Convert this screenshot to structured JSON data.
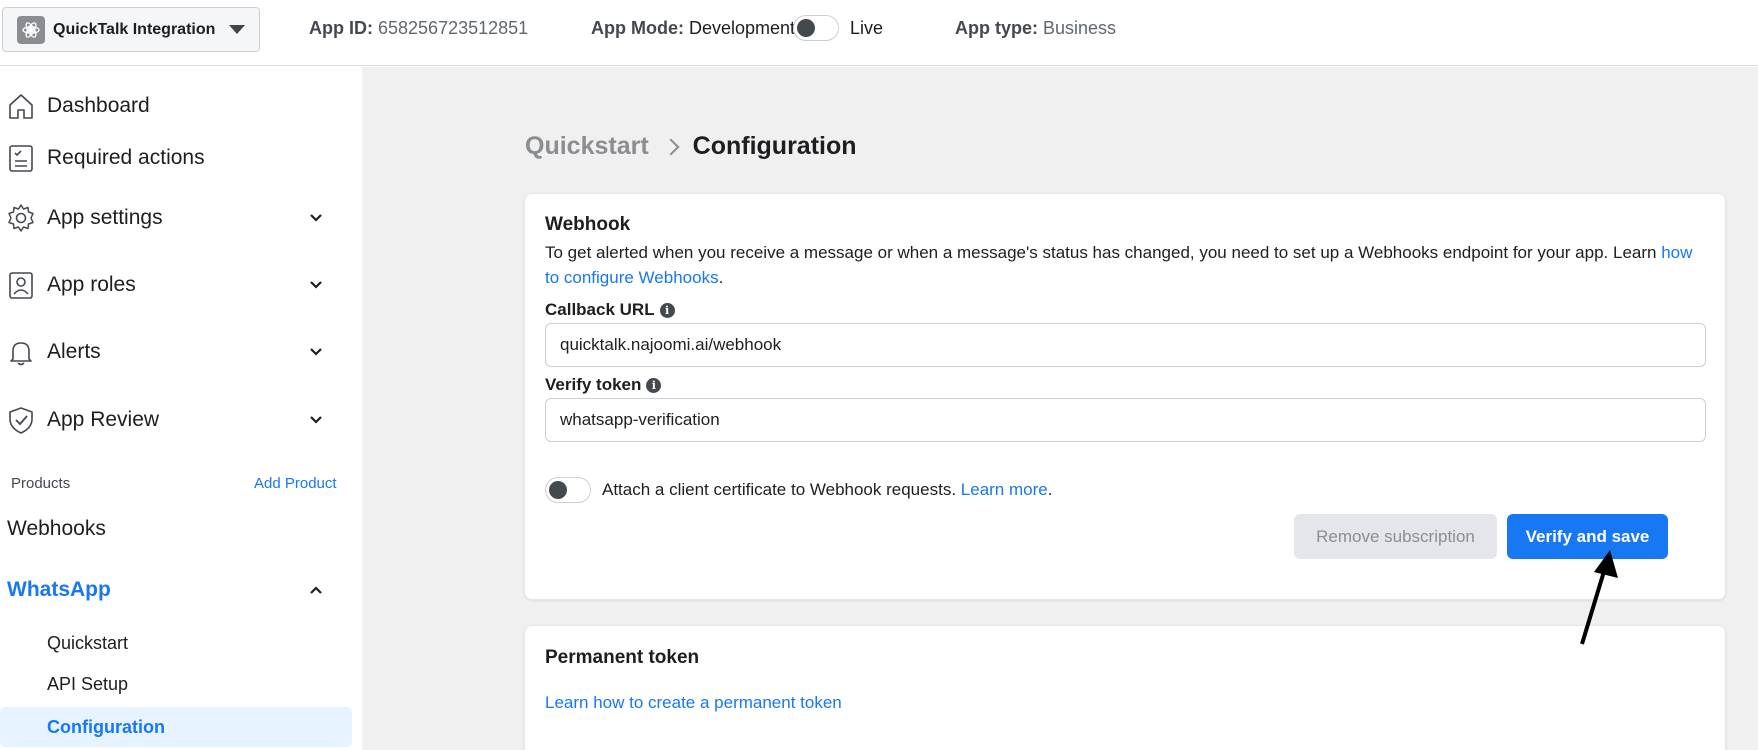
{
  "topbar": {
    "app_name": "QuickTalk Integration",
    "app_id_label": "App ID:",
    "app_id_value": "658256723512851",
    "app_mode_label": "App Mode:",
    "app_mode_value": "Development",
    "live_label": "Live",
    "app_type_label": "App type:",
    "app_type_value": "Business"
  },
  "sidebar": {
    "items": [
      {
        "label": "Dashboard",
        "icon": "home-icon"
      },
      {
        "label": "Required actions",
        "icon": "checklist-icon"
      },
      {
        "label": "App settings",
        "icon": "gear-icon"
      },
      {
        "label": "App roles",
        "icon": "badge-icon"
      },
      {
        "label": "Alerts",
        "icon": "bell-icon"
      },
      {
        "label": "App Review",
        "icon": "shield-check-icon"
      }
    ],
    "products_label": "Products",
    "add_product": "Add Product",
    "webhooks": "Webhooks",
    "whatsapp": "WhatsApp",
    "whatsapp_sub": [
      "Quickstart",
      "API Setup",
      "Configuration"
    ]
  },
  "breadcrumb": {
    "parent": "Quickstart",
    "current": "Configuration"
  },
  "webhook": {
    "title": "Webhook",
    "description": "To get alerted when you receive a message or when a message's status has changed, you need to set up a Webhooks endpoint for your app. Learn",
    "description_link": "how to configure Webhooks",
    "description_end": ".",
    "callback_label": "Callback URL",
    "callback_value": "quicktalk.najoomi.ai/webhook",
    "verify_label": "Verify token",
    "verify_value": "whatsapp-verification",
    "cert_text": "Attach a client certificate to Webhook requests.",
    "cert_link": "Learn more",
    "cert_end": ".",
    "remove_button": "Remove subscription",
    "verify_button": "Verify and save"
  },
  "permanent": {
    "title": "Permanent token",
    "link": "Learn how to create a permanent token"
  },
  "colors": {
    "accent": "#1877f2",
    "active_bg": "#e7f3ff",
    "main_bg": "#f0f0f0"
  }
}
